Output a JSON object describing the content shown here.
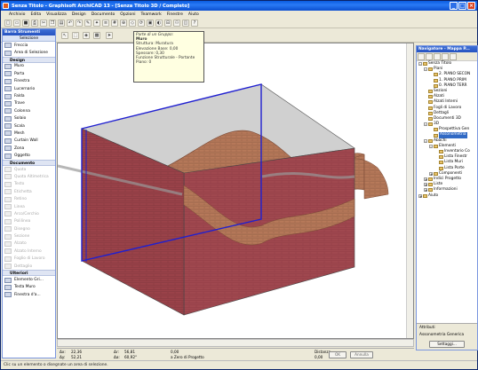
{
  "window": {
    "title": "Senza Titolo - Graphisoft ArchiCAD 13 - [Senza Titolo 3D / Completo]"
  },
  "menu": [
    "Archivio",
    "Edita",
    "Visualizza",
    "Design",
    "Documento",
    "Opzioni",
    "Teamwork",
    "Finestre",
    "Aiuto"
  ],
  "toolbox": {
    "title": "Barra Strumenti",
    "selection": "Selezione",
    "top_tools": [
      "Freccia",
      "Area di Selezione"
    ],
    "design_label": "Design",
    "design_tools": [
      "Muro",
      "Porta",
      "Finestra",
      "Lucernario",
      "Falda",
      "Trave",
      "Colonna",
      "Solaio",
      "Scala",
      "Mesh",
      "Curtain Wall",
      "Zona",
      "Oggetto"
    ],
    "document_label": "Documento",
    "document_tools": [
      "Quota",
      "Quota Altimetrica",
      "Testo",
      "Etichetta",
      "Retino",
      "Linea",
      "Arco/Cerchio",
      "Polilinea",
      "Disegno",
      "Sezione",
      "Alzato",
      "Alzato Interno",
      "Foglio di Lavoro",
      "Dettaglio"
    ],
    "more_label": "Ulteriori",
    "more_tools": [
      "Elemento Gri...",
      "Testa Muro",
      "Finestra d'a..."
    ]
  },
  "tooltip": {
    "line1": "Parte di un Gruppo:",
    "line2": "Muro",
    "line3": "Struttura: Muratura",
    "line4": "Elevazione Base: 0,00",
    "line5": "Spessore: 0,30",
    "line6": "Funzione Strutturale - Portante",
    "line7": "Piano: 0"
  },
  "navigator": {
    "title": "Navigatore - Mappa P...",
    "tree": [
      {
        "label": "Senza Titolo",
        "depth": 0,
        "exp": "-"
      },
      {
        "label": "Piani",
        "depth": 1,
        "exp": "-"
      },
      {
        "label": "2. PIANO SECON",
        "depth": 2,
        "exp": ""
      },
      {
        "label": "1. PIANO PRIM",
        "depth": 2,
        "exp": ""
      },
      {
        "label": "0. PIANO TERR",
        "depth": 2,
        "exp": ""
      },
      {
        "label": "Sezioni",
        "depth": 1,
        "exp": ""
      },
      {
        "label": "Alzati",
        "depth": 1,
        "exp": ""
      },
      {
        "label": "Alzati Interni",
        "depth": 1,
        "exp": ""
      },
      {
        "label": "Fogli di Lavoro",
        "depth": 1,
        "exp": ""
      },
      {
        "label": "Dettagli",
        "depth": 1,
        "exp": ""
      },
      {
        "label": "Documenti 3D",
        "depth": 1,
        "exp": ""
      },
      {
        "label": "3D",
        "depth": 1,
        "exp": "-"
      },
      {
        "label": "Prospettiva Gen",
        "depth": 2,
        "exp": ""
      },
      {
        "label": "Assonometria",
        "depth": 2,
        "exp": "",
        "sel": true
      },
      {
        "label": "Abachi",
        "depth": 1,
        "exp": "-"
      },
      {
        "label": "Elementi",
        "depth": 2,
        "exp": "-"
      },
      {
        "label": "Inventario Co",
        "depth": 3,
        "exp": ""
      },
      {
        "label": "Lista Finestr",
        "depth": 3,
        "exp": ""
      },
      {
        "label": "Lista Muri",
        "depth": 3,
        "exp": ""
      },
      {
        "label": "Lista Porte",
        "depth": 3,
        "exp": ""
      },
      {
        "label": "Componenti",
        "depth": 2,
        "exp": "+"
      },
      {
        "label": "Indici Progetto",
        "depth": 1,
        "exp": "+"
      },
      {
        "label": "Liste",
        "depth": 1,
        "exp": "+"
      },
      {
        "label": "Informazioni",
        "depth": 1,
        "exp": "+"
      },
      {
        "label": "Aiuto",
        "depth": 0,
        "exp": "+"
      }
    ],
    "attrib_label": "Attributi",
    "view_name": "Assonometria Generica",
    "settings_button": "Settaggi..."
  },
  "coords": {
    "dx": "22,36",
    "dy": "52,21",
    "r": "56,81",
    "a": "60,92°",
    "z": "0,00",
    "ref": "a Zero di Progetto",
    "dist_label": "Distanza",
    "dist_value": "0,00",
    "ok": "OK",
    "cancel": "Annulla"
  },
  "status": "Clic su un elemento o disegnate un area di selezione.",
  "colors": {
    "brick": "#a0484f",
    "brick_dark": "#8a3a42",
    "selection": "#2020d0",
    "wave": "#b87a5a"
  }
}
